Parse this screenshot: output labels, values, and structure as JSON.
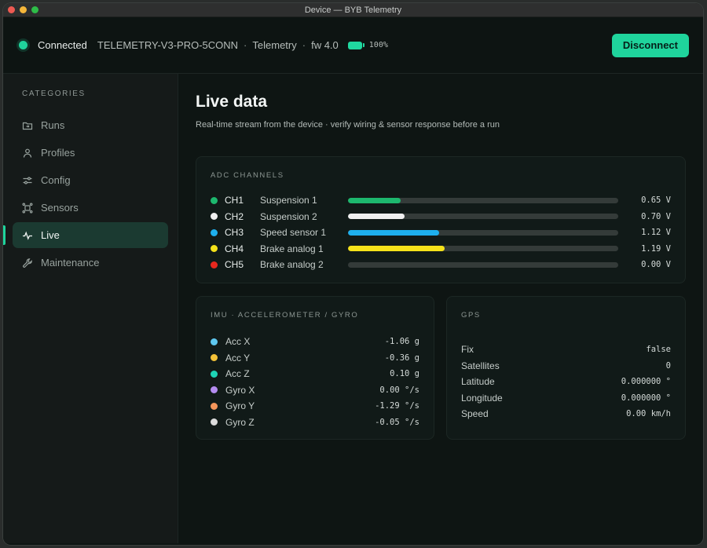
{
  "window": {
    "title": "Device — BYB Telemetry"
  },
  "topbar": {
    "status": "Connected",
    "device": "TELEMETRY-V3-PRO-5CONN",
    "mode": "Telemetry",
    "firmware": "fw 4.0",
    "battery": "100%",
    "battery_level": 1.0,
    "disconnect_label": "Disconnect",
    "status_color": "#1fd49c"
  },
  "sidebar": {
    "title": "CATEGORIES",
    "items": [
      {
        "label": "Runs",
        "icon": "folder-icon"
      },
      {
        "label": "Profiles",
        "icon": "user-icon"
      },
      {
        "label": "Config",
        "icon": "sliders-icon"
      },
      {
        "label": "Sensors",
        "icon": "sensor-icon"
      },
      {
        "label": "Live",
        "icon": "pulse-icon",
        "active": true
      },
      {
        "label": "Maintenance",
        "icon": "wrench-icon"
      }
    ]
  },
  "main": {
    "title": "Live data",
    "subtitle": "Real-time stream from the device · verify wiring & sensor response before a run"
  },
  "adc": {
    "title": "ADC CHANNELS",
    "channels": [
      {
        "id": "CH1",
        "name": "Suspension 1",
        "value": "0.65 V",
        "fraction": 0.195,
        "color": "#1db86e"
      },
      {
        "id": "CH2",
        "name": "Suspension 2",
        "value": "0.70 V",
        "fraction": 0.21,
        "color": "#f0f0f0"
      },
      {
        "id": "CH3",
        "name": "Speed sensor 1",
        "value": "1.12 V",
        "fraction": 0.336,
        "color": "#1eb0ee"
      },
      {
        "id": "CH4",
        "name": "Brake analog 1",
        "value": "1.19 V",
        "fraction": 0.357,
        "color": "#f5e21a"
      },
      {
        "id": "CH5",
        "name": "Brake analog 2",
        "value": "0.00 V",
        "fraction": 0.0,
        "color": "#e8281e"
      }
    ]
  },
  "imu": {
    "title": "IMU · ACCELEROMETER / GYRO",
    "rows": [
      {
        "label": "Acc X",
        "value": "-1.06 g",
        "color": "#5ec8f0"
      },
      {
        "label": "Acc Y",
        "value": "-0.36 g",
        "color": "#f4c238"
      },
      {
        "label": "Acc Z",
        "value": "0.10 g",
        "color": "#1ed4b6"
      },
      {
        "label": "Gyro X",
        "value": "0.00 °/s",
        "color": "#b48cf0"
      },
      {
        "label": "Gyro Y",
        "value": "-1.29 °/s",
        "color": "#f4955a"
      },
      {
        "label": "Gyro Z",
        "value": "-0.05 °/s",
        "color": "#dcdcdc"
      }
    ]
  },
  "gps": {
    "title": "GPS",
    "rows": [
      {
        "label": "Fix",
        "value": "false"
      },
      {
        "label": "Satellites",
        "value": "0"
      },
      {
        "label": "Latitude",
        "value": "0.000000 °"
      },
      {
        "label": "Longitude",
        "value": "0.000000 °"
      },
      {
        "label": "Speed",
        "value": "0.00 km/h"
      }
    ]
  }
}
